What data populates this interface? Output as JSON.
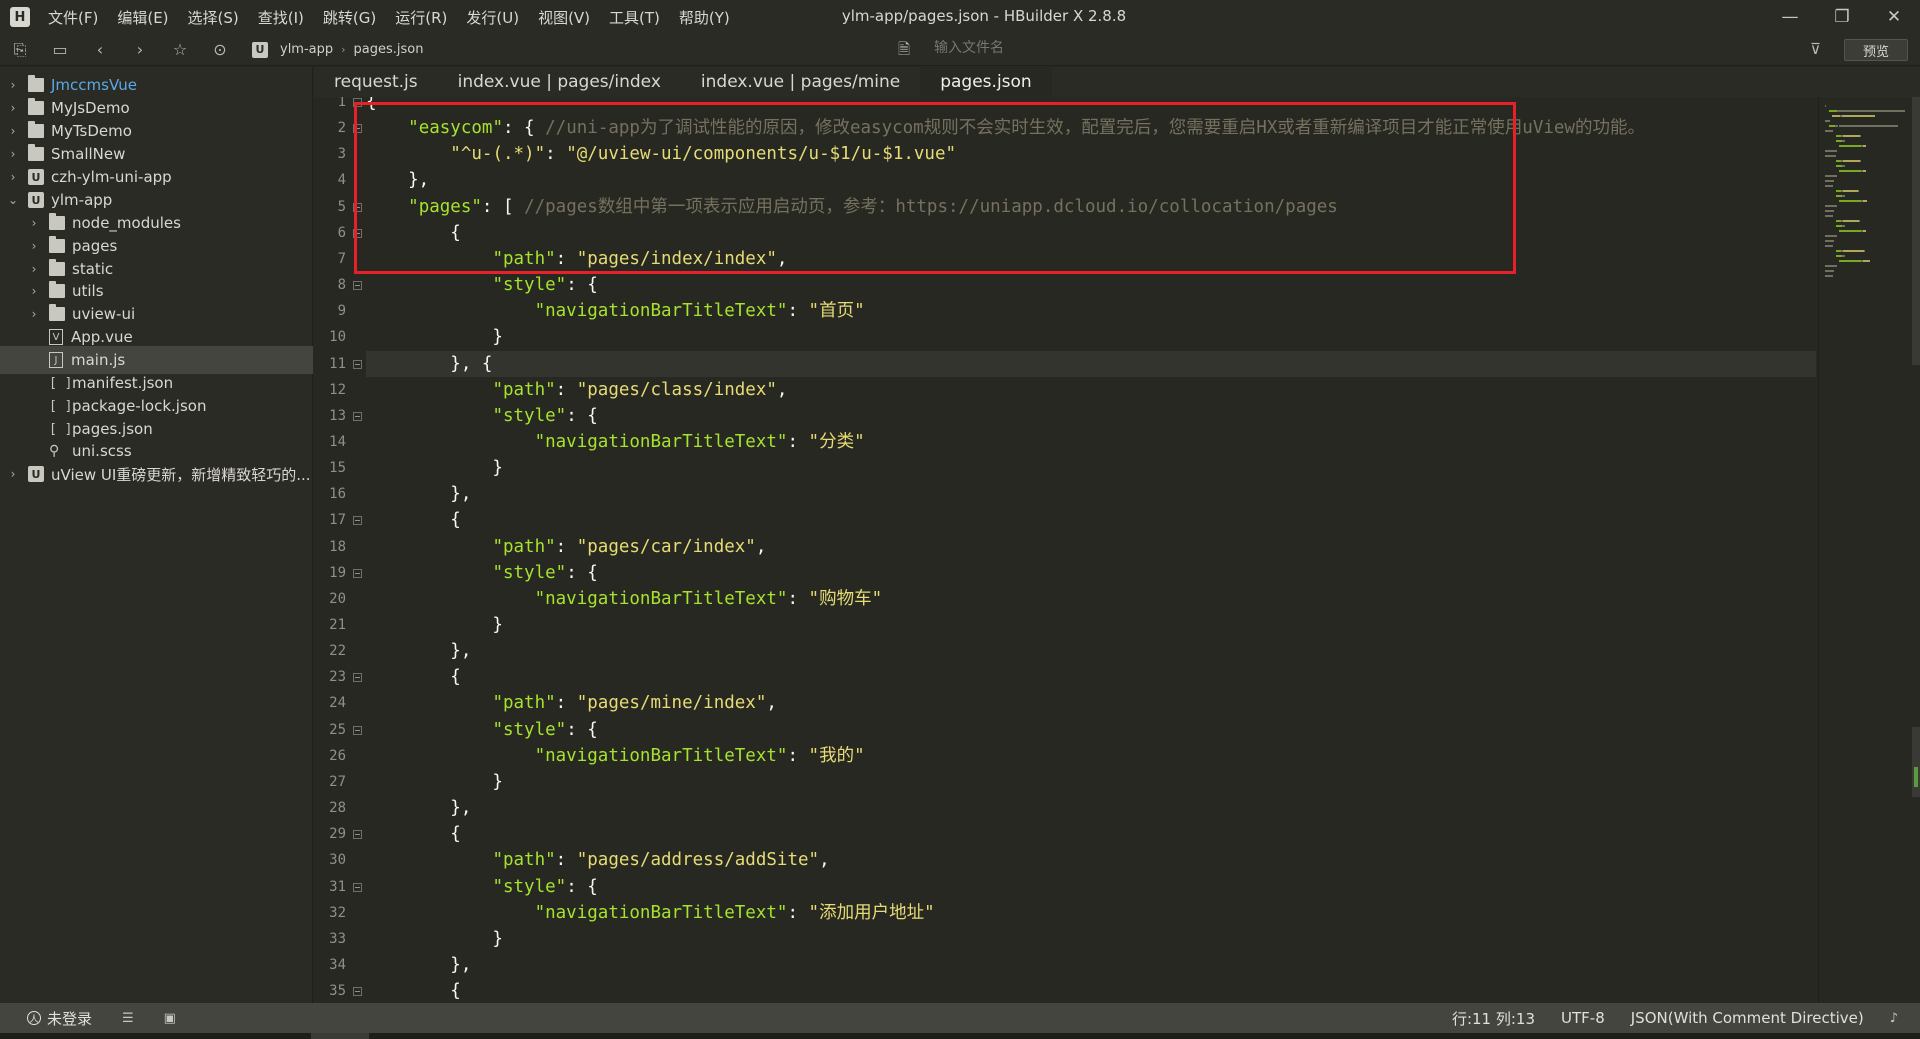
{
  "window": {
    "title": "ylm-app/pages.json - HBuilder X 2.8.8",
    "logo": "H",
    "menu": [
      "文件(F)",
      "编辑(E)",
      "选择(S)",
      "查找(I)",
      "跳转(G)",
      "运行(R)",
      "发行(U)",
      "视图(V)",
      "工具(T)",
      "帮助(Y)"
    ],
    "controls": {
      "minimize": "—",
      "maximize": "❐",
      "close": "✕"
    }
  },
  "toolbar": {
    "icons": {
      "new": "⎘",
      "save": "▭",
      "back": "‹",
      "forward": "›",
      "star": "☆",
      "run": "⊙"
    },
    "breadcrumb": {
      "icon": "U",
      "project": "ylm-app",
      "separator": "›",
      "file": "pages.json"
    },
    "file_search_placeholder": "输入文件名",
    "filter_icon": "⊽",
    "preview_label": "预览"
  },
  "sidebar": {
    "items": [
      {
        "label": "JmccmsVue",
        "arrow": "›",
        "icon": "project-img",
        "depth": 0,
        "link": true
      },
      {
        "label": "MyJsDemo",
        "arrow": "›",
        "icon": "project-img",
        "depth": 0
      },
      {
        "label": "MyTsDemo",
        "arrow": "›",
        "icon": "project-img",
        "depth": 0
      },
      {
        "label": "SmallNew",
        "arrow": "›",
        "icon": "project-img",
        "depth": 0
      },
      {
        "label": "czh-ylm-uni-app",
        "arrow": "›",
        "icon": "project-u",
        "depth": 0
      },
      {
        "label": "ylm-app",
        "arrow": "⌄",
        "icon": "project-u",
        "depth": 0
      },
      {
        "label": "node_modules",
        "arrow": "›",
        "icon": "folder",
        "depth": 1
      },
      {
        "label": "pages",
        "arrow": "›",
        "icon": "folder",
        "depth": 1
      },
      {
        "label": "static",
        "arrow": "›",
        "icon": "folder",
        "depth": 1
      },
      {
        "label": "utils",
        "arrow": "›",
        "icon": "folder",
        "depth": 1
      },
      {
        "label": "uview-ui",
        "arrow": "›",
        "icon": "folder",
        "depth": 1
      },
      {
        "label": "App.vue",
        "arrow": "",
        "icon": "vue",
        "depth": 1
      },
      {
        "label": "main.js",
        "arrow": "",
        "icon": "js",
        "depth": 1,
        "selected": true
      },
      {
        "label": "manifest.json",
        "arrow": "",
        "icon": "json",
        "depth": 1
      },
      {
        "label": "package-lock.json",
        "arrow": "",
        "icon": "json",
        "depth": 1
      },
      {
        "label": "pages.json",
        "arrow": "",
        "icon": "json",
        "depth": 1
      },
      {
        "label": "uni.scss",
        "arrow": "",
        "icon": "scss",
        "depth": 1
      },
      {
        "label": "uView UI重磅更新，新增精致轻巧的...",
        "arrow": "›",
        "icon": "project-u",
        "depth": 0
      }
    ]
  },
  "tabs": [
    {
      "label": "request.js"
    },
    {
      "label": "index.vue | pages/index"
    },
    {
      "label": "index.vue | pages/mine"
    },
    {
      "label": "pages.json",
      "active": true
    }
  ],
  "editor": {
    "current_line": 11,
    "lines": [
      [
        {
          "t": "pun",
          "v": "{"
        }
      ],
      [
        {
          "t": "pun",
          "v": "    "
        },
        {
          "t": "key",
          "v": "\"easycom\""
        },
        {
          "t": "pun",
          "v": ": { "
        },
        {
          "t": "cmt",
          "v": "//uni-app为了调试性能的原因，修改easycom规则不会实时生效，配置完后，您需要重启HX或者重新编译项目才能正常使用uView的功能。"
        }
      ],
      [
        {
          "t": "pun",
          "v": "        "
        },
        {
          "t": "str",
          "v": "\"^u-(.*)\""
        },
        {
          "t": "pun",
          "v": ": "
        },
        {
          "t": "str",
          "v": "\"@/uview-ui/components/u-$1/u-$1.vue\""
        }
      ],
      [
        {
          "t": "pun",
          "v": "    },"
        }
      ],
      [
        {
          "t": "pun",
          "v": "    "
        },
        {
          "t": "key",
          "v": "\"pages\""
        },
        {
          "t": "pun",
          "v": ": [ "
        },
        {
          "t": "cmt",
          "v": "//pages数组中第一项表示应用启动页，参考：https://uniapp.dcloud.io/collocation/pages"
        }
      ],
      [
        {
          "t": "pun",
          "v": "        {"
        }
      ],
      [
        {
          "t": "pun",
          "v": "            "
        },
        {
          "t": "key",
          "v": "\"path\""
        },
        {
          "t": "pun",
          "v": ": "
        },
        {
          "t": "str",
          "v": "\"pages/index/index\""
        },
        {
          "t": "pun",
          "v": ","
        }
      ],
      [
        {
          "t": "pun",
          "v": "            "
        },
        {
          "t": "key",
          "v": "\"style\""
        },
        {
          "t": "pun",
          "v": ": {"
        }
      ],
      [
        {
          "t": "pun",
          "v": "                "
        },
        {
          "t": "key",
          "v": "\"navigationBarTitleText\""
        },
        {
          "t": "pun",
          "v": ": "
        },
        {
          "t": "str",
          "v": "\"首页\""
        }
      ],
      [
        {
          "t": "pun",
          "v": "            }"
        }
      ],
      [
        {
          "t": "pun",
          "v": "        }, {"
        }
      ],
      [
        {
          "t": "pun",
          "v": "            "
        },
        {
          "t": "key",
          "v": "\"path\""
        },
        {
          "t": "pun",
          "v": ": "
        },
        {
          "t": "str",
          "v": "\"pages/class/index\""
        },
        {
          "t": "pun",
          "v": ","
        }
      ],
      [
        {
          "t": "pun",
          "v": "            "
        },
        {
          "t": "key",
          "v": "\"style\""
        },
        {
          "t": "pun",
          "v": ": {"
        }
      ],
      [
        {
          "t": "pun",
          "v": "                "
        },
        {
          "t": "key",
          "v": "\"navigationBarTitleText\""
        },
        {
          "t": "pun",
          "v": ": "
        },
        {
          "t": "str",
          "v": "\"分类\""
        }
      ],
      [
        {
          "t": "pun",
          "v": "            }"
        }
      ],
      [
        {
          "t": "pun",
          "v": "        },"
        }
      ],
      [
        {
          "t": "pun",
          "v": "        {"
        }
      ],
      [
        {
          "t": "pun",
          "v": "            "
        },
        {
          "t": "key",
          "v": "\"path\""
        },
        {
          "t": "pun",
          "v": ": "
        },
        {
          "t": "str",
          "v": "\"pages/car/index\""
        },
        {
          "t": "pun",
          "v": ","
        }
      ],
      [
        {
          "t": "pun",
          "v": "            "
        },
        {
          "t": "key",
          "v": "\"style\""
        },
        {
          "t": "pun",
          "v": ": {"
        }
      ],
      [
        {
          "t": "pun",
          "v": "                "
        },
        {
          "t": "key",
          "v": "\"navigationBarTitleText\""
        },
        {
          "t": "pun",
          "v": ": "
        },
        {
          "t": "str",
          "v": "\"购物车\""
        }
      ],
      [
        {
          "t": "pun",
          "v": "            }"
        }
      ],
      [
        {
          "t": "pun",
          "v": "        },"
        }
      ],
      [
        {
          "t": "pun",
          "v": "        {"
        }
      ],
      [
        {
          "t": "pun",
          "v": "            "
        },
        {
          "t": "key",
          "v": "\"path\""
        },
        {
          "t": "pun",
          "v": ": "
        },
        {
          "t": "str",
          "v": "\"pages/mine/index\""
        },
        {
          "t": "pun",
          "v": ","
        }
      ],
      [
        {
          "t": "pun",
          "v": "            "
        },
        {
          "t": "key",
          "v": "\"style\""
        },
        {
          "t": "pun",
          "v": ": {"
        }
      ],
      [
        {
          "t": "pun",
          "v": "                "
        },
        {
          "t": "key",
          "v": "\"navigationBarTitleText\""
        },
        {
          "t": "pun",
          "v": ": "
        },
        {
          "t": "str",
          "v": "\"我的\""
        }
      ],
      [
        {
          "t": "pun",
          "v": "            }"
        }
      ],
      [
        {
          "t": "pun",
          "v": "        },"
        }
      ],
      [
        {
          "t": "pun",
          "v": "        {"
        }
      ],
      [
        {
          "t": "pun",
          "v": "            "
        },
        {
          "t": "key",
          "v": "\"path\""
        },
        {
          "t": "pun",
          "v": ": "
        },
        {
          "t": "str",
          "v": "\"pages/address/addSite\""
        },
        {
          "t": "pun",
          "v": ","
        }
      ],
      [
        {
          "t": "pun",
          "v": "            "
        },
        {
          "t": "key",
          "v": "\"style\""
        },
        {
          "t": "pun",
          "v": ": {"
        }
      ],
      [
        {
          "t": "pun",
          "v": "                "
        },
        {
          "t": "key",
          "v": "\"navigationBarTitleText\""
        },
        {
          "t": "pun",
          "v": ": "
        },
        {
          "t": "str",
          "v": "\"添加用户地址\""
        }
      ],
      [
        {
          "t": "pun",
          "v": "            }"
        }
      ],
      [
        {
          "t": "pun",
          "v": "        },"
        }
      ],
      [
        {
          "t": "pun",
          "v": "        {"
        }
      ]
    ],
    "fold_lines": [
      1,
      2,
      5,
      6,
      8,
      11,
      13,
      17,
      19,
      23,
      25,
      29,
      31,
      35
    ]
  },
  "statusbar": {
    "login_label": "未登录",
    "user_icon": "人",
    "list_icon": "☰",
    "console_icon": "▣",
    "position": "行:11  列:13",
    "encoding": "UTF-8",
    "language": "JSON(With Comment Directive)",
    "bell_icon": "♪"
  },
  "colors": {
    "keyword": "#a6e22e",
    "string": "#e6db74",
    "comment": "#75715e",
    "highlight_box": "#e8202a",
    "link": "#5ba8e8"
  }
}
